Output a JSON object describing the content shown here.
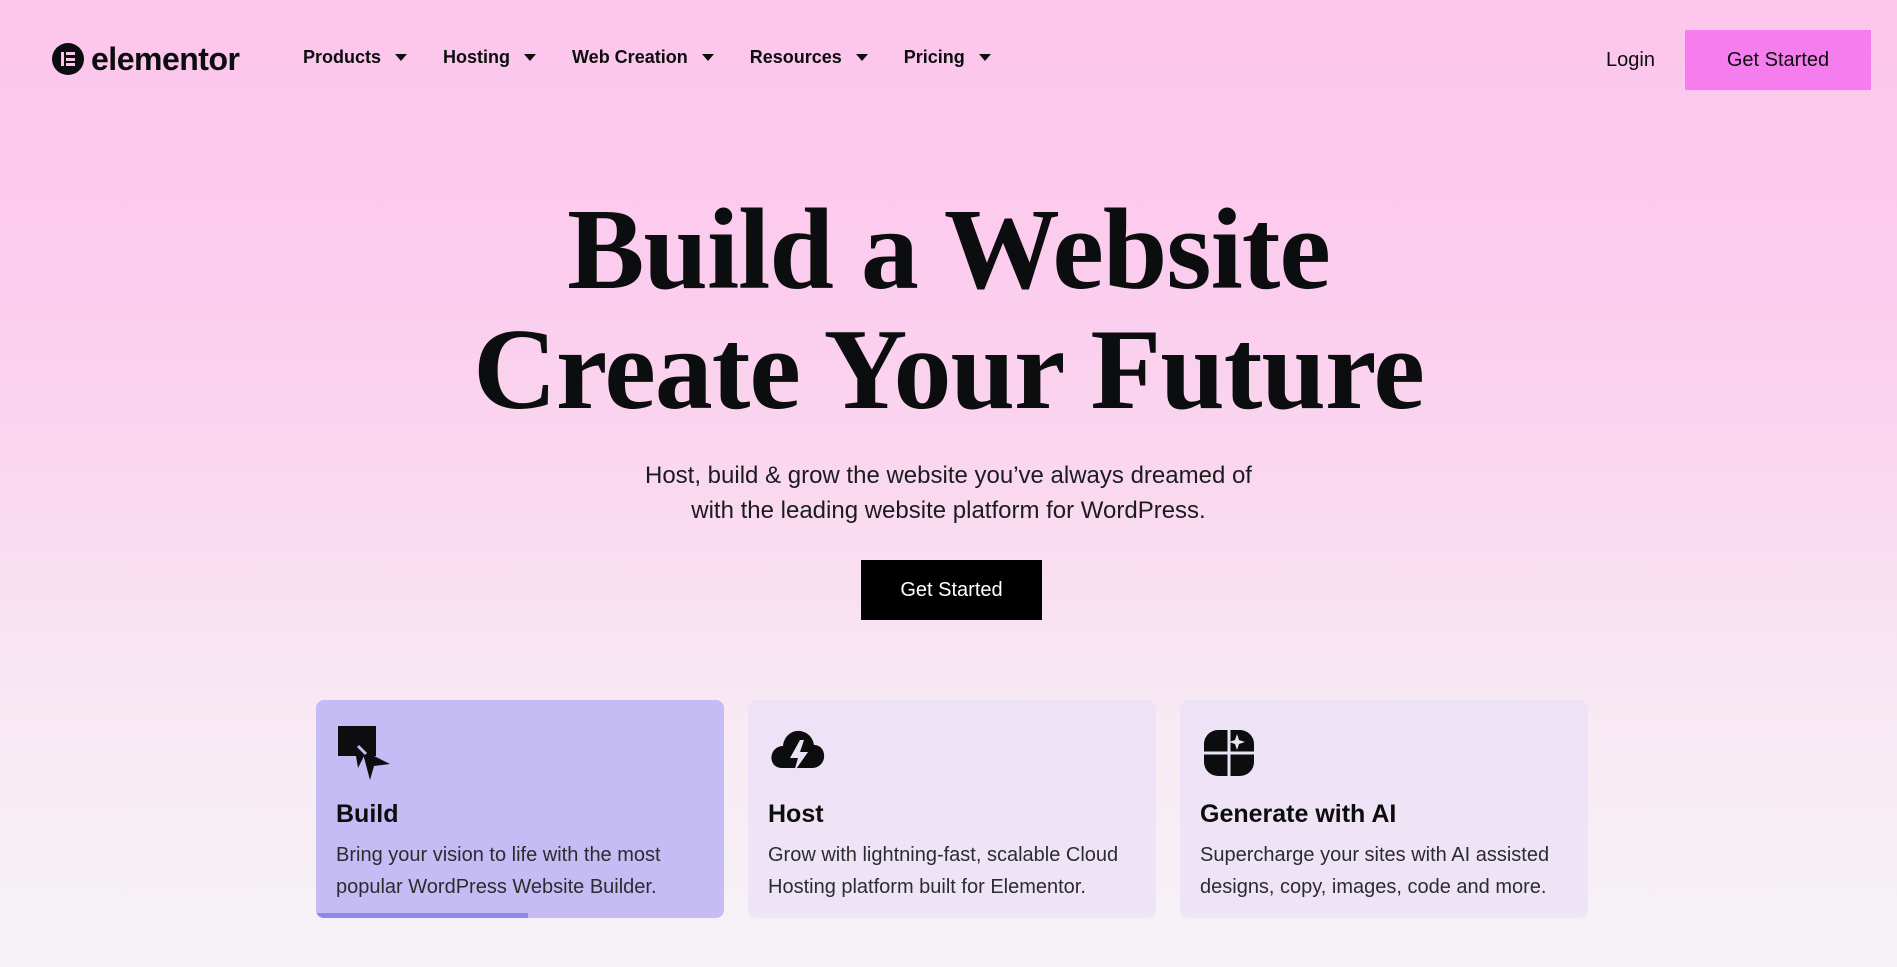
{
  "header": {
    "logo_text": "elementor",
    "nav": [
      {
        "label": "Products"
      },
      {
        "label": "Hosting"
      },
      {
        "label": "Web Creation"
      },
      {
        "label": "Resources"
      },
      {
        "label": "Pricing"
      }
    ],
    "login_label": "Login",
    "cta_label": "Get Started"
  },
  "hero": {
    "title_line1": "Build a Website",
    "title_line2": "Create Your Future",
    "subtitle_line1": "Host, build & grow the website you’ve always dreamed of",
    "subtitle_line2": "with the leading website platform for WordPress.",
    "cta_label": "Get Started"
  },
  "cards": [
    {
      "icon": "build-icon",
      "title": "Build",
      "desc_line1": "Bring your vision to life with the most",
      "desc_line2": "popular WordPress Website Builder.",
      "active": true,
      "progress": 0.52
    },
    {
      "icon": "cloud-lightning-icon",
      "title": "Host",
      "desc_line1": "Grow with lightning-fast, scalable Cloud",
      "desc_line2": "Hosting platform built for Elementor.",
      "active": false
    },
    {
      "icon": "ai-sparkle-icon",
      "title": "Generate with AI",
      "desc_line1": "Supercharge your sites with AI assisted",
      "desc_line2": "designs, copy, images, code and more.",
      "active": false
    }
  ],
  "colors": {
    "accent_pink": "#f67ded",
    "active_card": "#c5bbf5",
    "progress": "#8f84f0",
    "text": "#0c0d0e"
  }
}
